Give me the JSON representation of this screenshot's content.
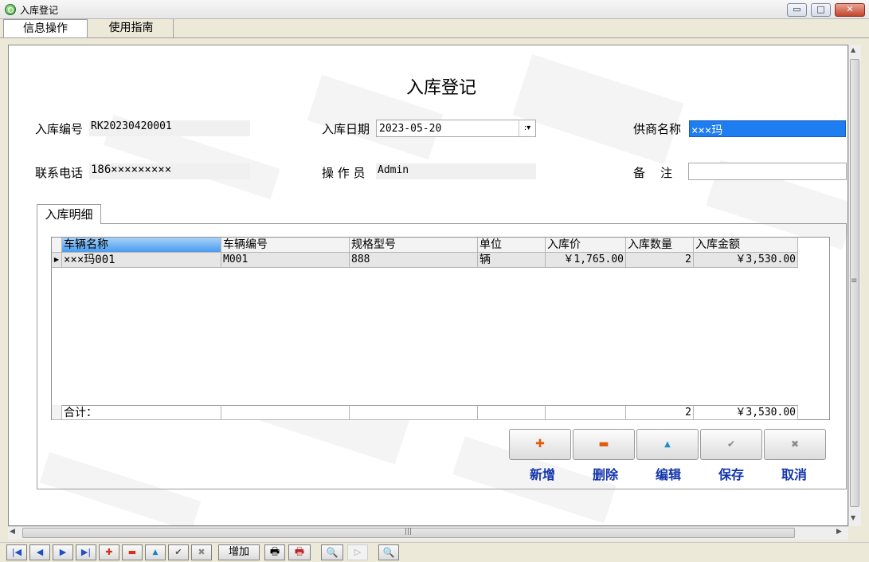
{
  "window": {
    "title": "入库登记",
    "min_glyph": "▭",
    "max_glyph": "□",
    "close_glyph": "✕"
  },
  "menu": {
    "tabs": [
      {
        "label": "信息操作",
        "active": true
      },
      {
        "label": "使用指南",
        "active": false
      }
    ]
  },
  "form": {
    "title": "入库登记",
    "fields": {
      "entry_no": {
        "label": "入库编号",
        "value": "RK20230420001"
      },
      "entry_date": {
        "label": "入库日期",
        "value": "2023-05-20"
      },
      "supplier": {
        "label": "供商名称",
        "value": "×××玛"
      },
      "phone": {
        "label": "联系电话",
        "value": "186×××××××××"
      },
      "operator": {
        "label": "操 作 员",
        "value": "Admin"
      },
      "remark": {
        "label": "备    注",
        "value": ""
      }
    }
  },
  "detail": {
    "tab_label": "入库明细",
    "columns": [
      "车辆名称",
      "车辆编号",
      "规格型号",
      "单位",
      "入库价",
      "入库数量",
      "入库金额"
    ],
    "rows": [
      [
        "×××玛001",
        "M001",
        "888",
        "辆",
        "￥1,765.00",
        "2",
        "￥3,530.00"
      ]
    ],
    "footer": [
      "合计：",
      "",
      "",
      "",
      "",
      "2",
      "￥3,530.00"
    ]
  },
  "actions": [
    {
      "label": "新增",
      "icon": "plus-icon",
      "glyph": "✚",
      "color": "#e05a10"
    },
    {
      "label": "删除",
      "icon": "minus-icon",
      "glyph": "▬",
      "color": "#e05a10"
    },
    {
      "label": "编辑",
      "icon": "up-triangle-icon",
      "glyph": "▲",
      "color": "#1f8fbf"
    },
    {
      "label": "保存",
      "icon": "check-icon",
      "glyph": "✔",
      "color": "#777777"
    },
    {
      "label": "取消",
      "icon": "x-icon",
      "glyph": "✖",
      "color": "#777777"
    }
  ],
  "navbar": {
    "first_glyph": "|◀",
    "prev_glyph": "◀",
    "next_glyph": "▶",
    "last_glyph": "▶|",
    "add_glyph": "✚",
    "del_glyph": "▬",
    "edit_glyph": "▲",
    "save_glyph": "✔",
    "cancel_glyph": "✖",
    "add_label": "增加",
    "print_glyph": "🖶",
    "print2_glyph": "🖶",
    "preview_glyph": "🔍",
    "play_glyph": "▷",
    "zoom_glyph": "🔍"
  }
}
